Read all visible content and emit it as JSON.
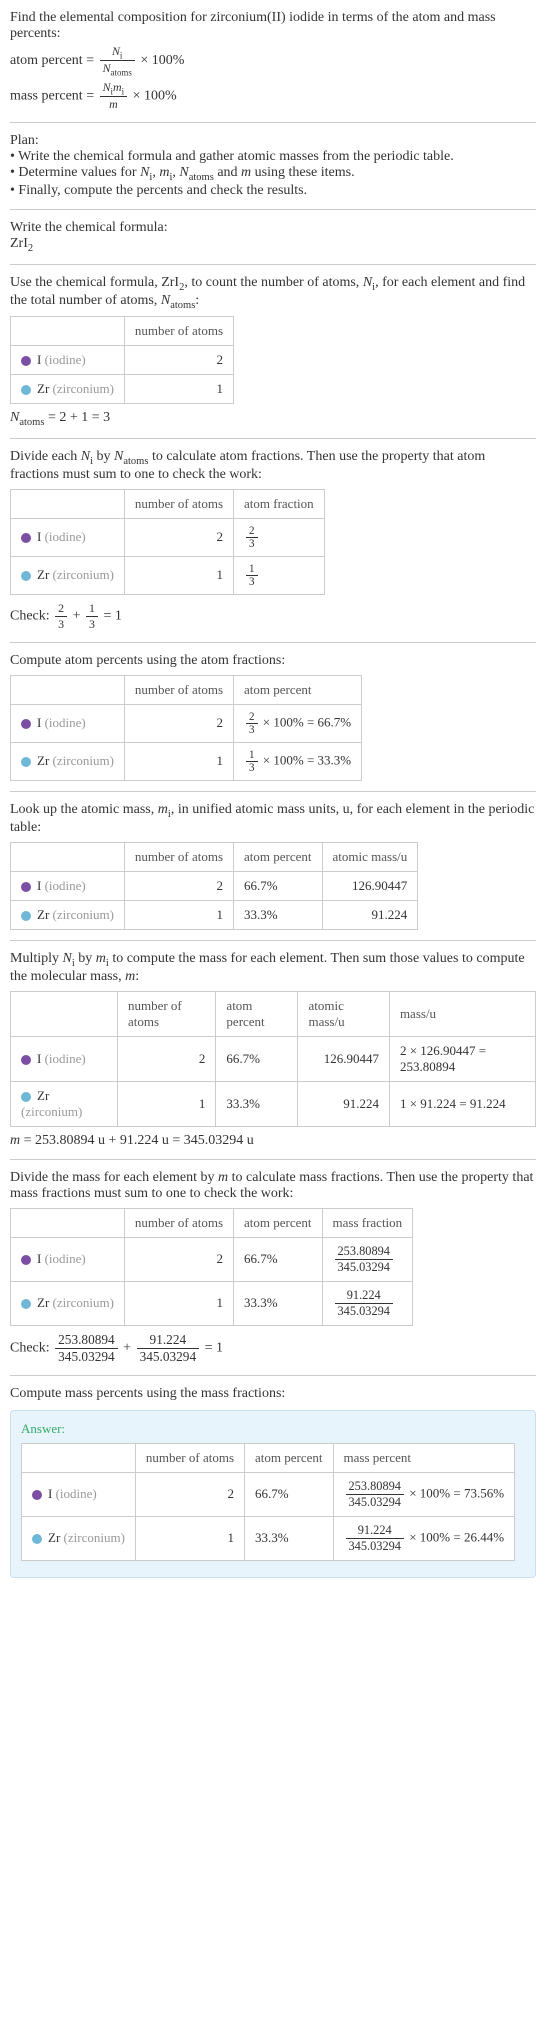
{
  "intro": {
    "line1": "Find the elemental composition for zirconium(II) iodide in terms of the atom and mass percents:",
    "atom_percent_label": "atom percent",
    "mass_percent_label": "mass percent",
    "eq": "=",
    "times100": " × 100%",
    "Ni": "N",
    "Ni_sub": "i",
    "Natoms": "N",
    "Natoms_sub": "atoms",
    "mi_top_N": "N",
    "mi_top_i": "i",
    "mi_top_m": "m",
    "m": "m"
  },
  "plan": {
    "title": "Plan:",
    "b1": "• Write the chemical formula and gather atomic masses from the periodic table.",
    "b2_a": "• Determine values for ",
    "b2_b": " using these items.",
    "b3": "• Finally, compute the percents and check the results.",
    "vars": {
      "Ni": "N",
      "i": "i",
      "mi": "m",
      "Natoms": "N",
      "atoms": "atoms",
      "and": " and ",
      "m": "m",
      "comma": ", "
    }
  },
  "formula_section": {
    "title": "Write the chemical formula:",
    "formula": "ZrI",
    "sub": "2"
  },
  "count_section": {
    "intro_a": "Use the chemical formula, ZrI",
    "intro_sub": "2",
    "intro_b": ", to count the number of atoms, ",
    "intro_c": ", for each element and find the total number of atoms, ",
    "intro_d": ":",
    "Ni": "N",
    "i": "i",
    "Natoms": "N",
    "atoms": "atoms",
    "headers": {
      "el": "",
      "natoms": "number of atoms"
    },
    "rows": [
      {
        "dot": "i",
        "el": "I",
        "elgrey": "(iodine)",
        "n": "2"
      },
      {
        "dot": "zr",
        "el": "Zr",
        "elgrey": "(zirconium)",
        "n": "1"
      }
    ],
    "sumline": {
      "lhs_N": "N",
      "lhs_sub": "atoms",
      "rhs": " = 2 + 1 = 3"
    }
  },
  "atomfrac_section": {
    "intro_a": "Divide each ",
    "intro_b": " by ",
    "intro_c": " to calculate atom fractions. Then use the property that atom fractions must sum to one to check the work:",
    "Ni": "N",
    "i": "i",
    "Natoms": "N",
    "atoms": "atoms",
    "headers": {
      "natoms": "number of atoms",
      "afrac": "atom fraction"
    },
    "rows": [
      {
        "dot": "i",
        "el": "I",
        "elgrey": "(iodine)",
        "n": "2",
        "frac_top": "2",
        "frac_bot": "3"
      },
      {
        "dot": "zr",
        "el": "Zr",
        "elgrey": "(zirconium)",
        "n": "1",
        "frac_top": "1",
        "frac_bot": "3"
      }
    ],
    "check_label": "Check: ",
    "check_plus": " + ",
    "check_eq": " = 1"
  },
  "atompct_section": {
    "intro": "Compute atom percents using the atom fractions:",
    "headers": {
      "natoms": "number of atoms",
      "apct": "atom percent"
    },
    "rows": [
      {
        "dot": "i",
        "el": "I",
        "elgrey": "(iodine)",
        "n": "2",
        "ft": "2",
        "fb": "3",
        "res": " × 100% = 66.7%"
      },
      {
        "dot": "zr",
        "el": "Zr",
        "elgrey": "(zirconium)",
        "n": "1",
        "ft": "1",
        "fb": "3",
        "res": " × 100% = 33.3%"
      }
    ]
  },
  "atommass_section": {
    "intro_a": "Look up the atomic mass, ",
    "intro_b": ", in unified atomic mass units, u, for each element in the periodic table:",
    "mi": "m",
    "i": "i",
    "headers": {
      "natoms": "number of atoms",
      "apct": "atom percent",
      "amass": "atomic mass/u"
    },
    "rows": [
      {
        "dot": "i",
        "el": "I",
        "elgrey": "(iodine)",
        "n": "2",
        "pct": "66.7%",
        "mass": "126.90447"
      },
      {
        "dot": "zr",
        "el": "Zr",
        "elgrey": "(zirconium)",
        "n": "1",
        "pct": "33.3%",
        "mass": "91.224"
      }
    ]
  },
  "molmass_section": {
    "intro_a": "Multiply ",
    "intro_b": " by ",
    "intro_c": " to compute the mass for each element. Then sum those values to compute the molecular mass, ",
    "intro_d": ":",
    "Ni": "N",
    "i_sub": "i",
    "mi": "m",
    "m": "m",
    "headers": {
      "natoms": "number of atoms",
      "apct": "atom percent",
      "amass": "atomic mass/u",
      "massu": "mass/u"
    },
    "rows": [
      {
        "dot": "i",
        "el": "I",
        "elgrey": "(iodine)",
        "n": "2",
        "pct": "66.7%",
        "amass": "126.90447",
        "massu": "2 × 126.90447 = 253.80894"
      },
      {
        "dot": "zr",
        "el": "Zr",
        "elgrey": "(zirconium)",
        "n": "1",
        "pct": "33.3%",
        "amass": "91.224",
        "massu": "1 × 91.224 = 91.224"
      }
    ],
    "sumline": {
      "m": "m",
      "rest": " = 253.80894 u + 91.224 u = 345.03294 u"
    }
  },
  "massfrac_section": {
    "intro_a": "Divide the mass for each element by ",
    "intro_b": " to calculate mass fractions. Then use the property that mass fractions must sum to one to check the work:",
    "m": "m",
    "headers": {
      "natoms": "number of atoms",
      "apct": "atom percent",
      "mfrac": "mass fraction"
    },
    "rows": [
      {
        "dot": "i",
        "el": "I",
        "elgrey": "(iodine)",
        "n": "2",
        "pct": "66.7%",
        "ft": "253.80894",
        "fb": "345.03294"
      },
      {
        "dot": "zr",
        "el": "Zr",
        "elgrey": "(zirconium)",
        "n": "1",
        "pct": "33.3%",
        "ft": "91.224",
        "fb": "345.03294"
      }
    ],
    "check_label": "Check: ",
    "check_plus": " + ",
    "check_eq": " = 1"
  },
  "masspct_section": {
    "intro": "Compute mass percents using the mass fractions:"
  },
  "answer": {
    "label": "Answer:",
    "headers": {
      "natoms": "number of atoms",
      "apct": "atom percent",
      "mpct": "mass percent"
    },
    "rows": [
      {
        "dot": "i",
        "el": "I",
        "elgrey": "(iodine)",
        "n": "2",
        "pct": "66.7%",
        "ft": "253.80894",
        "fb": "345.03294",
        "tail": " × 100% = 73.56%"
      },
      {
        "dot": "zr",
        "el": "Zr",
        "elgrey": "(zirconium)",
        "n": "1",
        "pct": "33.3%",
        "ft": "91.224",
        "fb": "345.03294",
        "tail": " × 100% = 26.44%"
      }
    ]
  }
}
